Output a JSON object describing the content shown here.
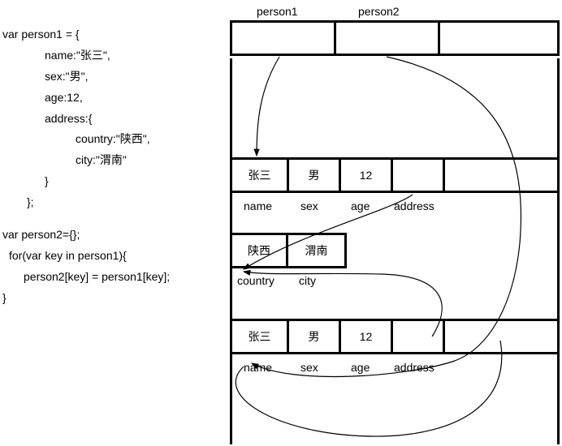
{
  "code": {
    "l1": "var person1 = {",
    "l2": "name:\"张三\",",
    "l3": "sex:\"男\",",
    "l4": "age:12,",
    "l5": "address:{",
    "l6": "country:\"陕西\",",
    "l7": "city:\"渭南\"",
    "l8": "}",
    "l9": "};",
    "l10": "var person2={};",
    "l11": "for(var key in person1){",
    "l12": "person2[key] = person1[key];",
    "l13": "}"
  },
  "header": {
    "person1": "person1",
    "person2": "person2"
  },
  "obj1": {
    "name": "张三",
    "sex": "男",
    "age": "12",
    "lbl_name": "name",
    "lbl_sex": "sex",
    "lbl_age": "age",
    "lbl_address": "address"
  },
  "addr": {
    "country": "陕西",
    "city": "渭南",
    "lbl_country": "country",
    "lbl_city": "city"
  },
  "obj2": {
    "name": "张三",
    "sex": "男",
    "age": "12",
    "lbl_name": "name",
    "lbl_sex": "sex",
    "lbl_age": "age",
    "lbl_address": "address"
  }
}
